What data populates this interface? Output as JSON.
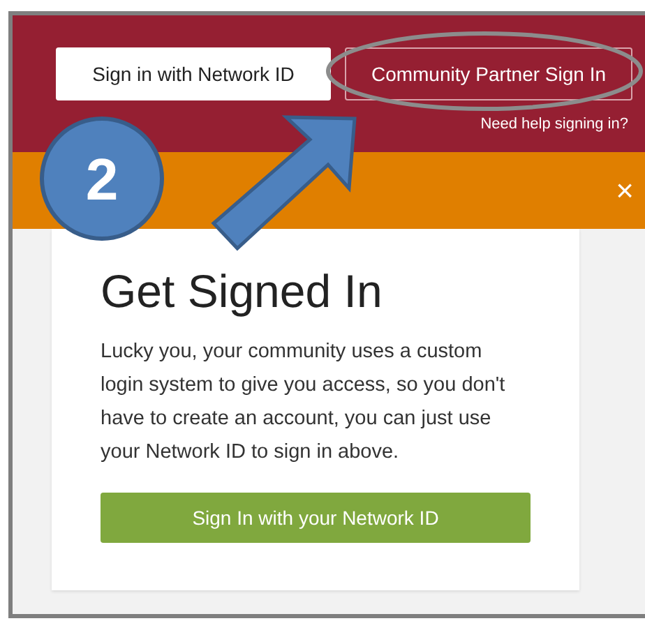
{
  "header": {
    "buttons": [
      {
        "label": "Sign in with Network ID",
        "kind": "solid"
      },
      {
        "label": "Community Partner Sign In",
        "kind": "outline"
      }
    ],
    "help_link": "Need help signing in?"
  },
  "banner": {
    "close": "×"
  },
  "card": {
    "title": "Get Signed In",
    "text": "Lucky you, your community uses a custom login system to give you access, so you don't have to create an account, you can just use your Network ID to sign in above.",
    "button": "Sign In with your Network ID"
  },
  "annotation": {
    "step": "2"
  }
}
